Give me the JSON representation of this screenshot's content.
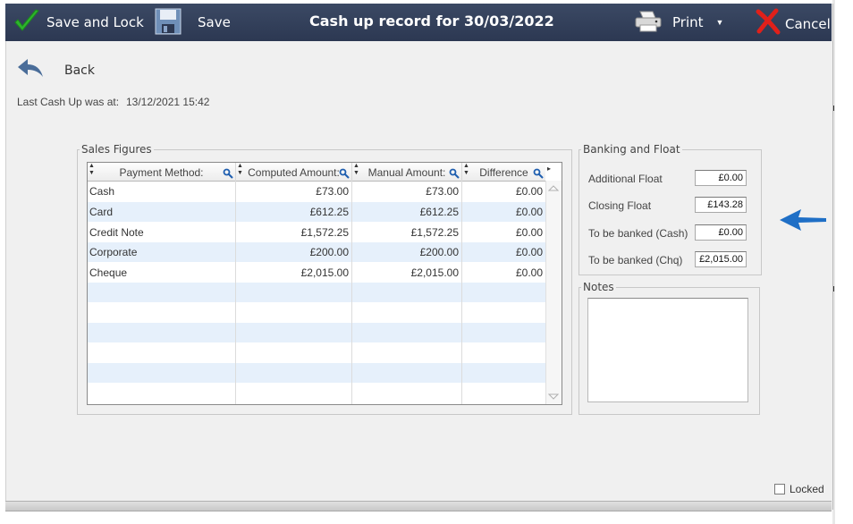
{
  "toolbar": {
    "save_lock_label": "Save and Lock",
    "save_label": "Save",
    "title": "Cash up record for 30/03/2022",
    "print_label": "Print",
    "cancel_label": "Cancel"
  },
  "back_label": "Back",
  "last_cash": {
    "label": "Last Cash Up was at:",
    "value": "13/12/2021 15:42"
  },
  "sales": {
    "legend": "Sales Figures",
    "columns": [
      "Payment Method:",
      "Computed Amount:",
      "Manual Amount:",
      "Difference"
    ],
    "rows": [
      [
        "Cash",
        "£73.00",
        "£73.00",
        "£0.00"
      ],
      [
        "Card",
        "£612.25",
        "£612.25",
        "£0.00"
      ],
      [
        "Credit Note",
        "£1,572.25",
        "£1,572.25",
        "£0.00"
      ],
      [
        "Corporate",
        "£200.00",
        "£200.00",
        "£0.00"
      ],
      [
        "Cheque",
        "£2,015.00",
        "£2,015.00",
        "£0.00"
      ]
    ]
  },
  "banking": {
    "legend": "Banking and Float",
    "fields": [
      {
        "label": "Additional Float",
        "value": "£0.00"
      },
      {
        "label": "Closing  Float",
        "value": "£143.28"
      },
      {
        "label": "To be banked (Cash)",
        "value": "£0.00"
      },
      {
        "label": "To be banked (Chq)",
        "value": "£2,015.00"
      }
    ]
  },
  "notes": {
    "legend": "Notes",
    "value": ""
  },
  "locked_label": "Locked",
  "colors": {
    "toolbar_bg": "#34415c",
    "row_alt": "#e6f0fb",
    "accent_arrow": "#1f6fc6",
    "check_green": "#2db52d",
    "cancel_red": "#e0201a"
  }
}
